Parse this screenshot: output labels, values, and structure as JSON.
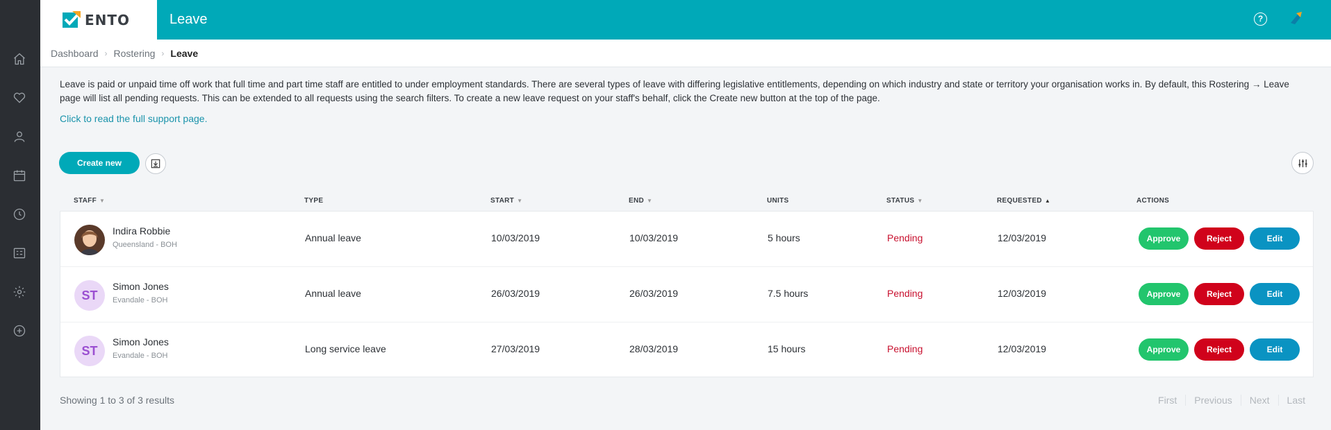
{
  "app": {
    "logo_text": "ENTO",
    "page_title": "Leave"
  },
  "sidebar": {
    "items": [
      {
        "icon": "home-icon"
      },
      {
        "icon": "heart-icon"
      },
      {
        "icon": "user-icon"
      },
      {
        "icon": "calendar-icon"
      },
      {
        "icon": "clock-icon"
      },
      {
        "icon": "checklist-icon"
      },
      {
        "icon": "gear-icon"
      },
      {
        "icon": "plus-circle-icon"
      }
    ]
  },
  "breadcrumb": {
    "items": [
      "Dashboard",
      "Rostering",
      "Leave"
    ],
    "separator": "›"
  },
  "intro": {
    "text": "Leave is paid or unpaid time off work that full time and part time staff are entitled to under employment standards. There are several types of leave with differing legislative entitlements, depending on which industry and state or territory your organisation works in. By default, this Rostering → Leave page will list all pending requests. This can be extended to all requests using the search filters. To create a new leave request on your staff's behalf, click the Create new button at the top of the page.",
    "support_link": "Click to read the full support page."
  },
  "toolbar": {
    "create_label": "Create new"
  },
  "table": {
    "headers": {
      "staff": "STAFF",
      "type": "TYPE",
      "start": "START",
      "end": "END",
      "units": "UNITS",
      "status": "STATUS",
      "requested": "REQUESTED",
      "actions": "ACTIONS"
    },
    "sort_glyphs": {
      "desc": "▼",
      "asc": "▲"
    },
    "rows": [
      {
        "name": "Indira Robbie",
        "location": "Queensland - BOH",
        "initials": "",
        "type": "Annual leave",
        "start": "10/03/2019",
        "end": "10/03/2019",
        "units": "5 hours",
        "status": "Pending",
        "requested": "12/03/2019"
      },
      {
        "name": "Simon Jones",
        "location": "Evandale - BOH",
        "initials": "ST",
        "type": "Annual leave",
        "start": "26/03/2019",
        "end": "26/03/2019",
        "units": "7.5 hours",
        "status": "Pending",
        "requested": "12/03/2019"
      },
      {
        "name": "Simon Jones",
        "location": "Evandale - BOH",
        "initials": "ST",
        "type": "Long service leave",
        "start": "27/03/2019",
        "end": "28/03/2019",
        "units": "15 hours",
        "status": "Pending",
        "requested": "12/03/2019"
      }
    ],
    "actions": {
      "approve": "Approve",
      "reject": "Reject",
      "edit": "Edit"
    }
  },
  "footer": {
    "showing": "Showing 1 to 3 of 3 results",
    "pager": [
      "First",
      "Previous",
      "Next",
      "Last"
    ]
  },
  "colors": {
    "brand": "#00a9b8",
    "sidebar": "#2b2e33",
    "approve": "#22c56d",
    "reject": "#d0021b",
    "edit": "#0a93c2",
    "pending": "#c8102e"
  }
}
